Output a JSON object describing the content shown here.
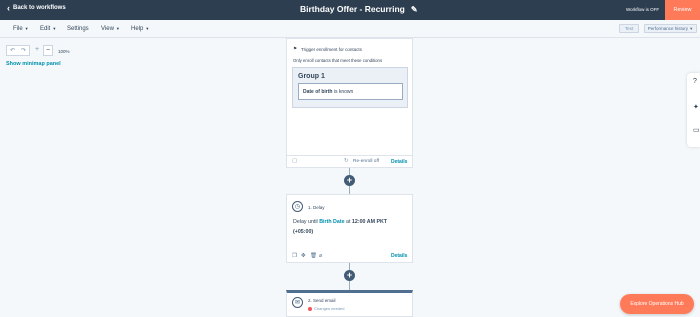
{
  "topbar": {
    "back_label": "Back to workflows",
    "workflow_title": "Birthday Offer - Recurring",
    "status": "Workflow is OFF",
    "review_label": "Review"
  },
  "menu": {
    "file": "File",
    "edit": "Edit",
    "settings": "Settings",
    "view": "View",
    "help": "Help",
    "test_label": "Test",
    "performance_label": "Performance history"
  },
  "zoom": {
    "level": "100%",
    "minimap_label": "Show minimap panel"
  },
  "trigger": {
    "header": "Trigger enrollment for contacts",
    "subtitle": "Only enroll contacts that meet these conditions",
    "group_title": "Group 1",
    "condition_property": "Date of birth",
    "condition_rest": "is known",
    "reenroll": "Re-enroll off",
    "details": "Details"
  },
  "delay": {
    "title": "1. Delay",
    "text_prefix": "Delay until",
    "property": "Birth Date",
    "text_at": "at",
    "time": "12:00 AM PKT (+05:00)",
    "details": "Details"
  },
  "email": {
    "title": "2. Send email",
    "status": "Changes needed"
  },
  "explore_label": "Explore Operations Hub",
  "colors": {
    "topbar": "#2d3e50",
    "accent": "#ff7a59",
    "link": "#0091ae"
  }
}
